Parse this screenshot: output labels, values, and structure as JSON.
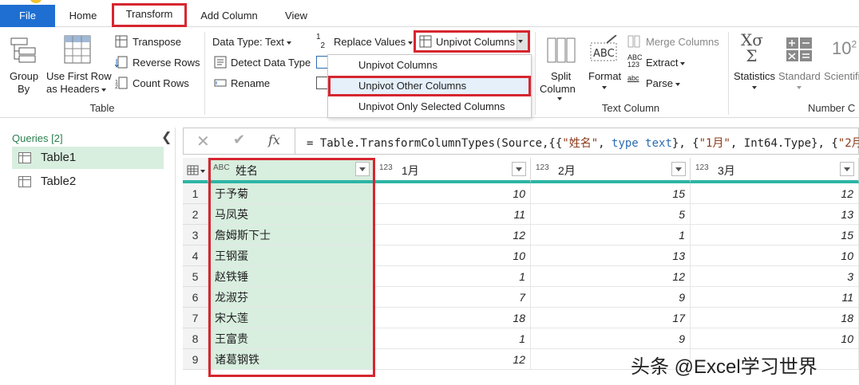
{
  "tabs": {
    "file": "File",
    "home": "Home",
    "transform": "Transform",
    "add_column": "Add Column",
    "view": "View"
  },
  "ribbon": {
    "table_group": {
      "label": "Table",
      "group_by": [
        "Group",
        "By"
      ],
      "use_first_row": [
        "Use First Row",
        "as Headers"
      ],
      "transpose": "Transpose",
      "reverse_rows": "Reverse Rows",
      "count_rows": "Count Rows"
    },
    "any_column_group": {
      "data_type": "Data Type: Text",
      "detect_data_type": "Detect Data Type",
      "rename": "Rename",
      "replace_values": "Replace Values",
      "unpivot_columns": "Unpivot Columns"
    },
    "text_column_group": {
      "label": "Text Column",
      "split_column": [
        "Split",
        "Column"
      ],
      "format": "Format",
      "merge_columns": "Merge Columns",
      "extract": "Extract",
      "parse": "Parse"
    },
    "number_column_group": {
      "label": "Number C",
      "statistics": "Statistics",
      "standard": "Standard",
      "scientific": "Scientifi"
    }
  },
  "unpivot_menu": {
    "items": [
      "Unpivot Columns",
      "Unpivot Other Columns",
      "Unpivot Only Selected Columns"
    ],
    "highlighted": "Unpivot Other Columns"
  },
  "queries": {
    "title": "Queries [2]",
    "items": [
      "Table1",
      "Table2"
    ],
    "selected": "Table1"
  },
  "formula_bar": {
    "text_parts": [
      "= Table.TransformColumnTypes(Source,{{",
      "\"姓名\"",
      ", ",
      "type",
      " ",
      "text",
      "}, {",
      "\"1月\"",
      ", Int64.Type}, {",
      "\"2月\""
    ]
  },
  "table": {
    "columns": [
      {
        "type": "ABC",
        "name": "姓名"
      },
      {
        "type": "123",
        "name": "1月"
      },
      {
        "type": "123",
        "name": "2月"
      },
      {
        "type": "123",
        "name": "3月"
      }
    ],
    "rows": [
      [
        "1",
        "于予菊",
        "10",
        "15",
        "12"
      ],
      [
        "2",
        "马凤英",
        "11",
        "5",
        "13"
      ],
      [
        "3",
        "詹姆斯下士",
        "12",
        "1",
        "15"
      ],
      [
        "4",
        "王钢蛋",
        "10",
        "13",
        "10"
      ],
      [
        "5",
        "赵铁锤",
        "1",
        "12",
        "3"
      ],
      [
        "6",
        "龙淑芬",
        "7",
        "9",
        "11"
      ],
      [
        "7",
        "宋大莲",
        "18",
        "17",
        "18"
      ],
      [
        "8",
        "王富贵",
        "1",
        "9",
        "10"
      ],
      [
        "9",
        "诸葛钢铁",
        "12",
        "",
        ""
      ]
    ]
  },
  "watermark": "头条 @Excel学习世界",
  "colors": {
    "accent_red": "#d6262f",
    "file_blue": "#1e6fd1",
    "header_teal": "#2db5a5",
    "selected_green": "#d8eedf"
  }
}
